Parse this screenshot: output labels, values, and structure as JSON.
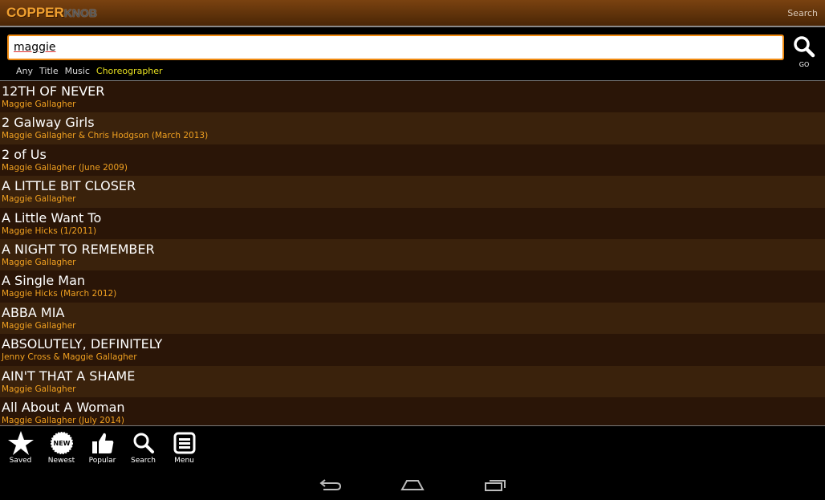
{
  "app": {
    "logo_main": "COPPER",
    "logo_secondary": "KNOB",
    "top_action": "Search"
  },
  "search": {
    "value": "maggie",
    "go_label": "GO"
  },
  "filters": [
    {
      "label": "Any",
      "active": false
    },
    {
      "label": "Title",
      "active": false
    },
    {
      "label": "Music",
      "active": false
    },
    {
      "label": "Choreographer",
      "active": true
    }
  ],
  "results": [
    {
      "title": "12TH OF NEVER",
      "sub": "Maggie Gallagher"
    },
    {
      "title": "2 Galway Girls",
      "sub": "Maggie Gallagher & Chris Hodgson (March 2013)"
    },
    {
      "title": "2 of Us",
      "sub": "Maggie Gallagher (June 2009)"
    },
    {
      "title": "A LITTLE BIT CLOSER",
      "sub": "Maggie Gallagher"
    },
    {
      "title": "A Little Want To",
      "sub": "Maggie Hicks (1/2011)"
    },
    {
      "title": "A NIGHT TO REMEMBER",
      "sub": "Maggie Gallagher"
    },
    {
      "title": "A Single Man",
      "sub": "Maggie Hicks (March 2012)"
    },
    {
      "title": "ABBA MIA",
      "sub": "Maggie Gallagher"
    },
    {
      "title": "ABSOLUTELY, DEFINITELY",
      "sub": "Jenny Cross & Maggie Gallagher"
    },
    {
      "title": "AIN'T THAT A SHAME",
      "sub": "Maggie Gallagher"
    },
    {
      "title": "All About A Woman",
      "sub": "Maggie Gallagher (July 2014)"
    }
  ],
  "bottom_nav": [
    {
      "label": "Saved",
      "icon": "star"
    },
    {
      "label": "Newest",
      "icon": "new-badge"
    },
    {
      "label": "Popular",
      "icon": "thumbs-up"
    },
    {
      "label": "Search",
      "icon": "search"
    },
    {
      "label": "Menu",
      "icon": "menu"
    }
  ],
  "colors": {
    "accent": "#f08a10",
    "subtitle": "#f0a020",
    "active_filter": "#e8e020"
  }
}
